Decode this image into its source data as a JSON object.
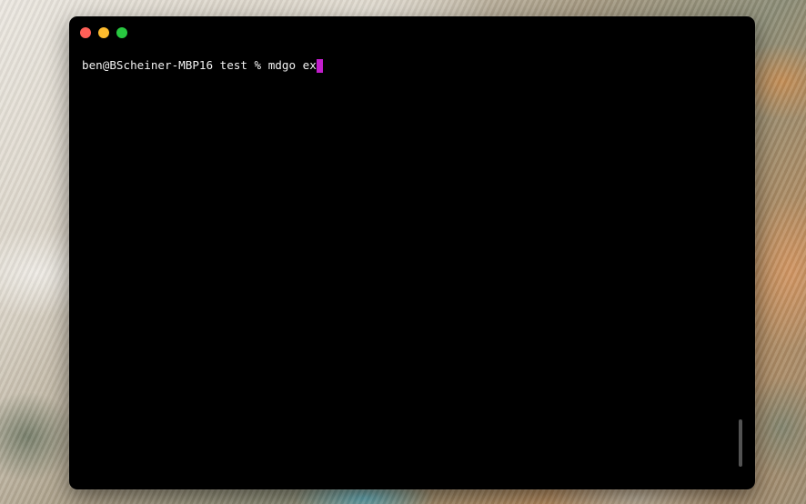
{
  "terminal": {
    "prompt": "ben@BScheiner-MBP16 test % ",
    "command": "mdgo ex",
    "cursor_color": "#c21ecc"
  },
  "window_controls": {
    "close_color": "#ff5f57",
    "minimize_color": "#febc2e",
    "zoom_color": "#28c840"
  },
  "colors": {
    "terminal_background": "#000000",
    "text": "#f2f2f2"
  }
}
